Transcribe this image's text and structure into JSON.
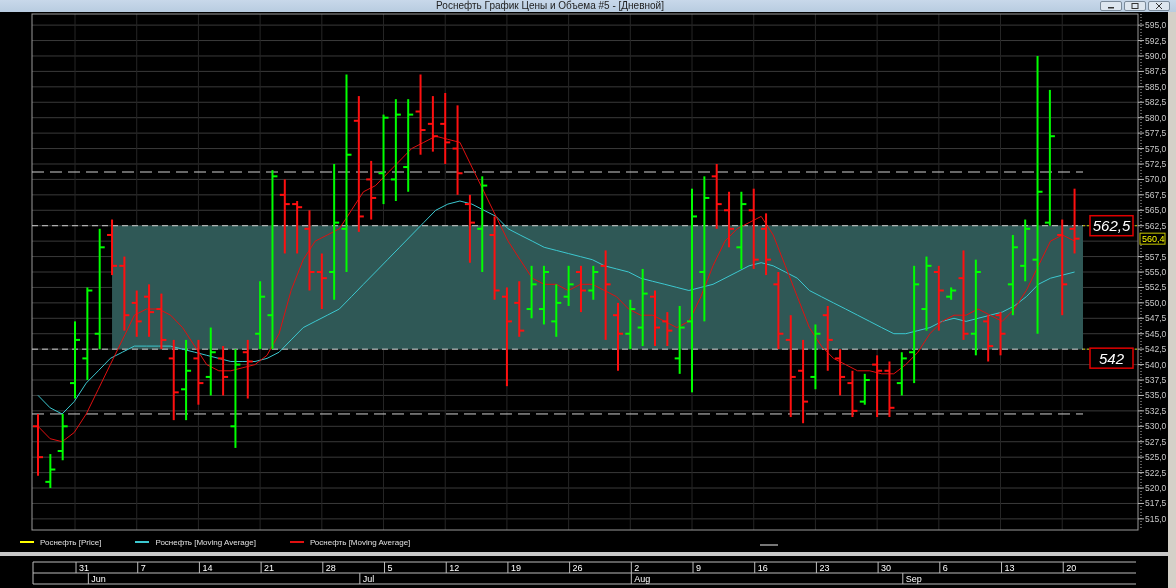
{
  "window": {
    "title": "Роснефть График Цены и Объема #5 - [Дневной]"
  },
  "chart": {
    "price_legend": {
      "label": "Роснефть [Price]",
      "color": "#ffff00"
    },
    "chart_data": {
      "type": "line",
      "grid": true,
      "ylim": [
        513.2,
        596.8
      ],
      "yticks": [
        {
          "value": 515,
          "label": "515,0"
        },
        {
          "value": 517.5,
          "label": "517,5"
        },
        {
          "value": 520,
          "label": "520,0"
        },
        {
          "value": 522.5,
          "label": "522,5"
        },
        {
          "value": 525,
          "label": "525,0"
        },
        {
          "value": 527.5,
          "label": "527,5"
        },
        {
          "value": 530,
          "label": "530,0"
        },
        {
          "value": 532.5,
          "label": "532,5"
        },
        {
          "value": 535,
          "label": "535,0"
        },
        {
          "value": 537.5,
          "label": "537,5"
        },
        {
          "value": 540,
          "label": "540,0"
        },
        {
          "value": 542.5,
          "label": "542,5"
        },
        {
          "value": 545,
          "label": "545,0"
        },
        {
          "value": 547.5,
          "label": "547,5"
        },
        {
          "value": 550,
          "label": "550,0"
        },
        {
          "value": 552.5,
          "label": "552,5"
        },
        {
          "value": 555,
          "label": "555,0"
        },
        {
          "value": 557.5,
          "label": "557,5"
        },
        {
          "value": 562.5,
          "label": "562,5"
        },
        {
          "value": 565,
          "label": "565,0"
        },
        {
          "value": 567.5,
          "label": "567,5"
        },
        {
          "value": 570,
          "label": "570,0"
        },
        {
          "value": 572.5,
          "label": "572,5"
        },
        {
          "value": 575,
          "label": "575,0"
        },
        {
          "value": 577.5,
          "label": "577,5"
        },
        {
          "value": 580,
          "label": "580,0"
        },
        {
          "value": 582.5,
          "label": "582,5"
        },
        {
          "value": 585,
          "label": "585,0"
        },
        {
          "value": 587.5,
          "label": "587,5"
        },
        {
          "value": 590,
          "label": "590,0"
        },
        {
          "value": 592.5,
          "label": "592,5"
        },
        {
          "value": 595,
          "label": "595,0"
        }
      ],
      "series": [
        {
          "name": "Роснефть [Moving Average]",
          "color": "#3cc8d0",
          "values": [
            535,
            533,
            532,
            534,
            537,
            539,
            541,
            542,
            543,
            543,
            543,
            543,
            542.5,
            542,
            541.5,
            541,
            540.5,
            540.5,
            540.5,
            541,
            542,
            544,
            546,
            547,
            548,
            549,
            551,
            553,
            555,
            557,
            559,
            561,
            563,
            565,
            566,
            566.5,
            566,
            565,
            564,
            562,
            561,
            560,
            559,
            558.5,
            558,
            557.5,
            557,
            556,
            555.5,
            555,
            554,
            553.5,
            553,
            552.5,
            552,
            552.5,
            553,
            554,
            555,
            556,
            556.5,
            556,
            555,
            554,
            552,
            551,
            550,
            549,
            548,
            547,
            546,
            545,
            545,
            545.5,
            546,
            547,
            547.5,
            547,
            547.5,
            548,
            548.5,
            549.5,
            551,
            553,
            554,
            554.5,
            555
          ]
        },
        {
          "name": "Роснефть [Moving Average]",
          "color": "#e01010",
          "values": [
            530,
            528,
            527.5,
            529,
            532,
            536,
            540,
            544,
            548,
            549,
            549,
            548,
            546,
            543,
            540,
            539,
            539,
            539.5,
            540,
            541.5,
            545,
            552,
            557,
            560,
            561,
            562,
            565,
            568,
            569,
            571,
            573,
            575,
            576,
            577,
            576.5,
            576,
            572,
            568,
            564,
            560,
            557,
            554,
            553,
            553,
            552,
            553,
            553,
            552,
            551,
            549,
            548,
            548,
            547,
            546,
            547,
            551,
            556,
            560,
            562,
            563,
            564,
            561,
            556,
            551,
            546,
            543,
            541,
            540,
            539,
            539,
            538.5,
            538.5,
            540,
            542,
            545,
            547,
            548,
            548,
            549,
            548,
            547,
            549,
            552,
            556,
            560,
            561,
            560
          ]
        }
      ],
      "annotations": [
        "562,5",
        "542"
      ]
    },
    "last_price": "560,4"
  },
  "timeline": {
    "weeks": [
      "31",
      "7",
      "14",
      "21",
      "28",
      "5",
      "12",
      "19",
      "26",
      "2",
      "9",
      "16",
      "23",
      "30",
      "6",
      "13",
      "20"
    ],
    "months": [
      "Jun",
      "Jul",
      "Aug",
      "Sep"
    ]
  }
}
